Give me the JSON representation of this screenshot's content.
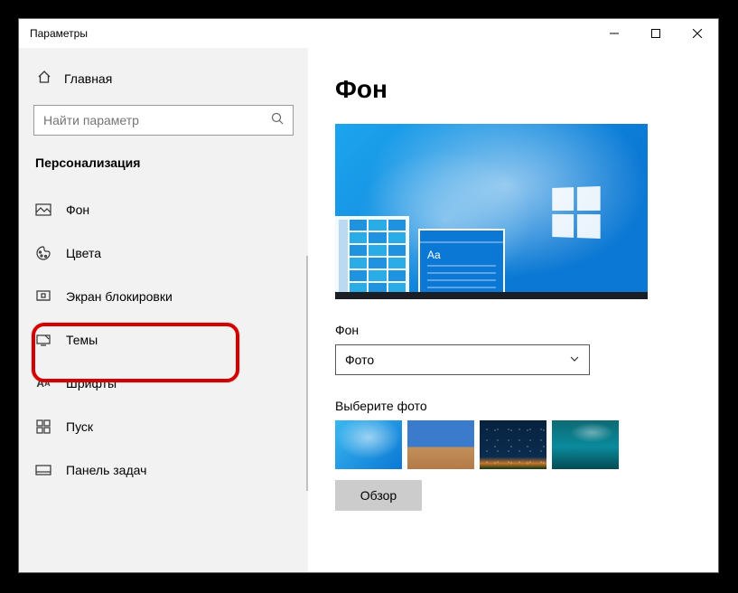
{
  "window": {
    "title": "Параметры"
  },
  "sidebar": {
    "home_label": "Главная",
    "search_placeholder": "Найти параметр",
    "category": "Персонализация",
    "items": [
      {
        "label": "Фон",
        "icon": "image-icon"
      },
      {
        "label": "Цвета",
        "icon": "palette-icon"
      },
      {
        "label": "Экран блокировки",
        "icon": "lock-screen-icon"
      },
      {
        "label": "Темы",
        "icon": "themes-icon"
      },
      {
        "label": "Шрифты",
        "icon": "fonts-icon"
      },
      {
        "label": "Пуск",
        "icon": "start-icon"
      },
      {
        "label": "Панель задач",
        "icon": "taskbar-icon"
      }
    ]
  },
  "main": {
    "heading": "Фон",
    "preview_sample_text": "Aa",
    "dropdown_label": "Фон",
    "dropdown_value": "Фото",
    "choose_label": "Выберите фото",
    "browse_label": "Обзор"
  }
}
